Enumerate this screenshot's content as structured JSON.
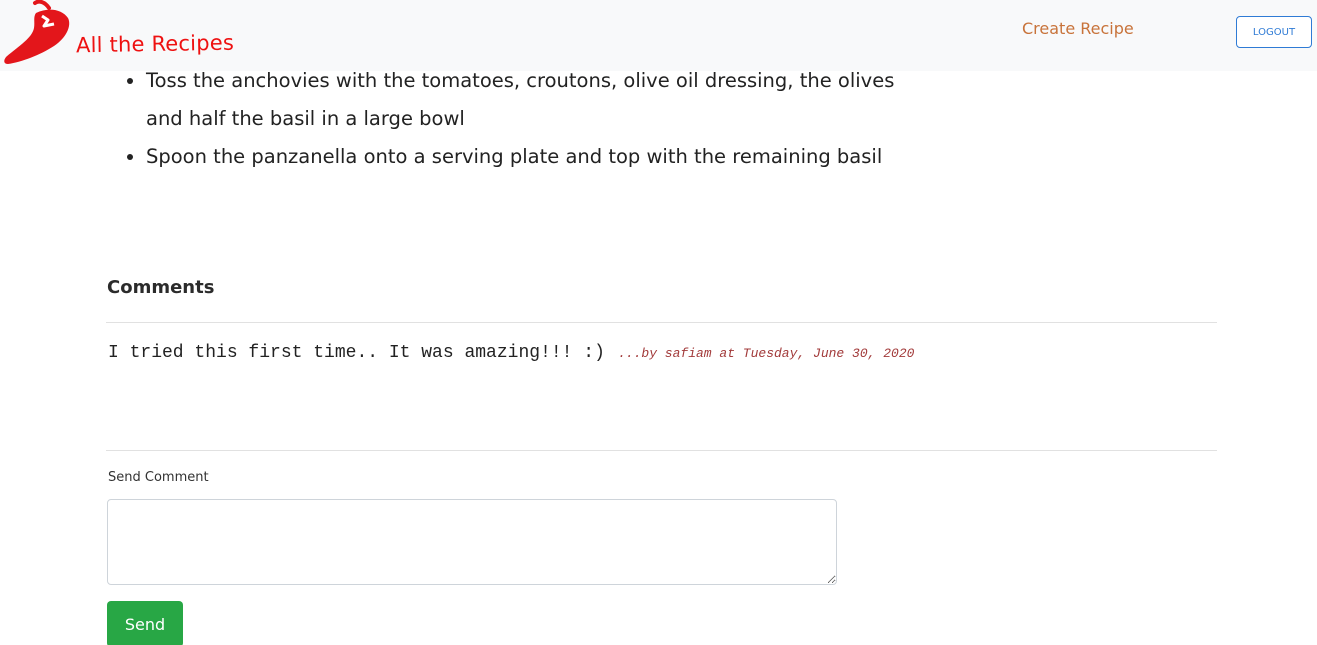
{
  "navbar": {
    "brand": "All the Recipes",
    "logo_icon": "chili-pepper-icon",
    "create_recipe": "Create Recipe",
    "logout": "LOGOUT"
  },
  "instructions": [
    "Toss the anchovies with the tomatoes, croutons, olive oil dressing, the olives and half the basil in a large bowl",
    "Spoon the panzanella onto a serving plate and top with the remaining basil"
  ],
  "comments": {
    "title": "Comments",
    "items": [
      {
        "text": "I tried this first time.. It was amazing!!! :)",
        "meta": "...by safiam at Tuesday, June 30, 2020"
      }
    ]
  },
  "form": {
    "label": "Send Comment",
    "placeholder": "",
    "send": "Send"
  },
  "colors": {
    "brand": "#ee1111",
    "nav_link": "#c8733a",
    "logout": "#2f7bd5",
    "send": "#28a745",
    "comment_meta": "#a23a3a"
  }
}
